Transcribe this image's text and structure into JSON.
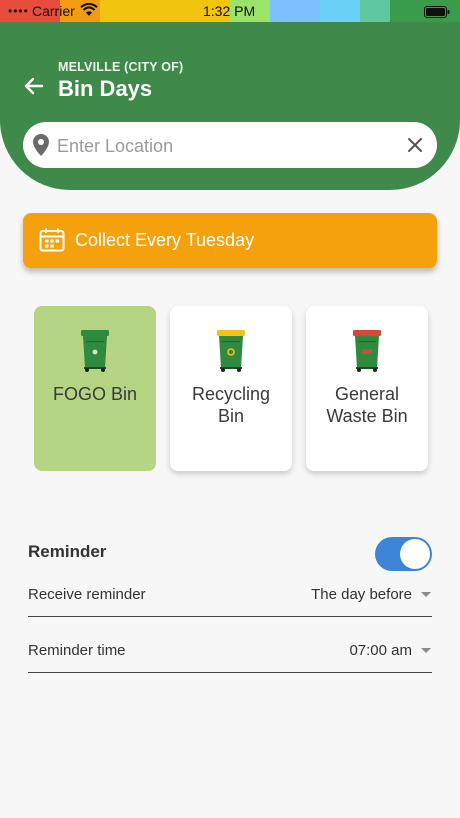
{
  "status_bar": {
    "carrier": "Carrier",
    "time": "1:32 PM",
    "stripe_colors": [
      "#e74c3c",
      "#f39c12",
      "#f1c40f",
      "#9be36a",
      "#7cc0ff",
      "#6ad0f5",
      "#60c8a0",
      "#3a9b4a"
    ]
  },
  "header": {
    "council": "MELVILLE (CITY OF)",
    "title": "Bin Days",
    "background_color": "#3f8a4b"
  },
  "search": {
    "placeholder": "Enter Location",
    "value": ""
  },
  "collection": {
    "label": "Collect Every Tuesday",
    "color": "#f5a10d"
  },
  "bins": [
    {
      "name": "FOGO Bin",
      "lid_color": "#2f8a3f",
      "selected": true
    },
    {
      "name": "Recycling Bin",
      "lid_color": "#f2c21b",
      "selected": false
    },
    {
      "name": "General Waste Bin",
      "lid_color": "#d9453a",
      "selected": false
    }
  ],
  "reminder": {
    "title": "Reminder",
    "enabled": true,
    "receive_label": "Receive reminder",
    "receive_value": "The day before",
    "time_label": "Reminder time",
    "time_value": "07:00 am"
  },
  "icons": {
    "back": "arrow-left-icon",
    "location": "location-pin-icon",
    "clear": "close-icon",
    "calendar": "calendar-icon",
    "bin": "wheelie-bin-icon"
  }
}
